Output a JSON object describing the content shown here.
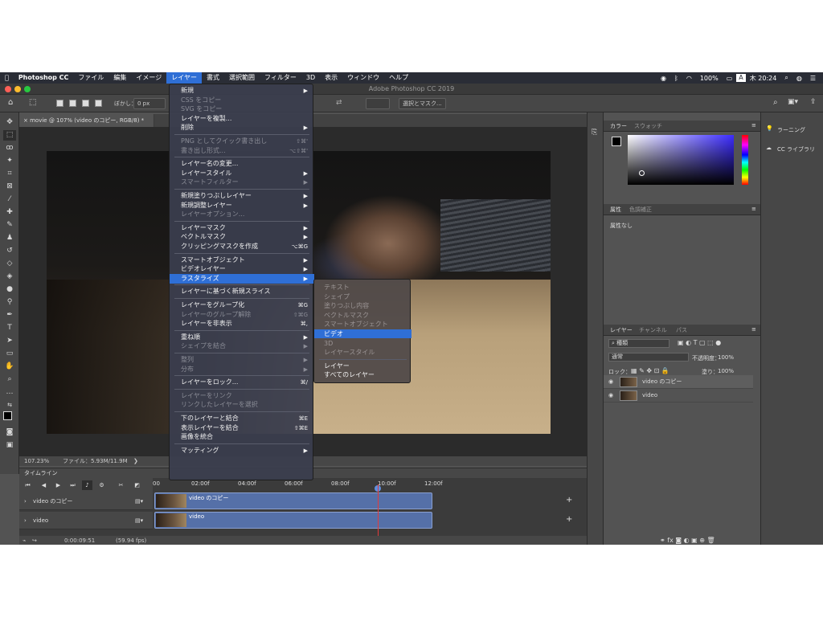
{
  "menubar": {
    "apple": "",
    "app": "Photoshop CC",
    "items": [
      "ファイル",
      "編集",
      "イメージ",
      "レイヤー",
      "書式",
      "選択範囲",
      "フィルター",
      "3D",
      "表示",
      "ウィンドウ",
      "ヘルプ"
    ],
    "active_index": 3,
    "battery": "100%",
    "clock": "木 20:24",
    "input_source": "A"
  },
  "window": {
    "title": "Adobe Photoshop CC 2019"
  },
  "options": {
    "feather_label": "ぼかし：",
    "feather_value": "0 px",
    "select_mask_label": "選択とマスク..."
  },
  "document": {
    "tab_label": "movie @ 107% (video のコピー, RGB/8) *",
    "zoom": "107.23%",
    "file_info": "ファイル：5.93M/11.9M"
  },
  "layer_menu": {
    "items": [
      {
        "label": "新規",
        "sc": "▶",
        "dis": false
      },
      {
        "label": "CSS をコピー",
        "sc": "",
        "dis": true
      },
      {
        "label": "SVG をコピー",
        "sc": "",
        "dis": true
      },
      {
        "label": "レイヤーを複製...",
        "sc": "",
        "dis": false
      },
      {
        "label": "削除",
        "sc": "▶",
        "dis": false
      },
      {
        "sep": true
      },
      {
        "label": "PNG としてクイック書き出し",
        "sc": "⇧⌘'",
        "dis": true
      },
      {
        "label": "書き出し形式...",
        "sc": "⌥⇧⌘'",
        "dis": true
      },
      {
        "sep": true
      },
      {
        "label": "レイヤー名の変更...",
        "sc": "",
        "dis": false
      },
      {
        "label": "レイヤースタイル",
        "sc": "▶",
        "dis": false
      },
      {
        "label": "スマートフィルター",
        "sc": "▶",
        "dis": true
      },
      {
        "sep": true
      },
      {
        "label": "新規塗りつぶしレイヤー",
        "sc": "▶",
        "dis": false
      },
      {
        "label": "新規調整レイヤー",
        "sc": "▶",
        "dis": false
      },
      {
        "label": "レイヤーオプション...",
        "sc": "",
        "dis": true
      },
      {
        "sep": true
      },
      {
        "label": "レイヤーマスク",
        "sc": "▶",
        "dis": false
      },
      {
        "label": "ベクトルマスク",
        "sc": "▶",
        "dis": false
      },
      {
        "label": "クリッピングマスクを作成",
        "sc": "⌥⌘G",
        "dis": false
      },
      {
        "sep": true
      },
      {
        "label": "スマートオブジェクト",
        "sc": "▶",
        "dis": false
      },
      {
        "label": "ビデオレイヤー",
        "sc": "▶",
        "dis": false
      },
      {
        "label": "ラスタライズ",
        "sc": "▶",
        "dis": false,
        "hl": true
      },
      {
        "sep": true
      },
      {
        "label": "レイヤーに基づく新規スライス",
        "sc": "",
        "dis": false
      },
      {
        "sep": true
      },
      {
        "label": "レイヤーをグループ化",
        "sc": "⌘G",
        "dis": false
      },
      {
        "label": "レイヤーのグループ解除",
        "sc": "⇧⌘G",
        "dis": true
      },
      {
        "label": "レイヤーを非表示",
        "sc": "⌘,",
        "dis": false
      },
      {
        "sep": true
      },
      {
        "label": "重ね順",
        "sc": "▶",
        "dis": false
      },
      {
        "label": "シェイプを結合",
        "sc": "▶",
        "dis": true
      },
      {
        "sep": true
      },
      {
        "label": "整列",
        "sc": "▶",
        "dis": true
      },
      {
        "label": "分布",
        "sc": "▶",
        "dis": true
      },
      {
        "sep": true
      },
      {
        "label": "レイヤーをロック...",
        "sc": "⌘/",
        "dis": false
      },
      {
        "sep": true
      },
      {
        "label": "レイヤーをリンク",
        "sc": "",
        "dis": true
      },
      {
        "label": "リンクしたレイヤーを選択",
        "sc": "",
        "dis": true
      },
      {
        "sep": true
      },
      {
        "label": "下のレイヤーと結合",
        "sc": "⌘E",
        "dis": false
      },
      {
        "label": "表示レイヤーを結合",
        "sc": "⇧⌘E",
        "dis": false
      },
      {
        "label": "画像を統合",
        "sc": "",
        "dis": false
      },
      {
        "sep": true
      },
      {
        "label": "マッティング",
        "sc": "▶",
        "dis": false
      }
    ]
  },
  "rasterize_submenu": {
    "items": [
      {
        "label": "テキスト",
        "dis": true
      },
      {
        "label": "シェイプ",
        "dis": true
      },
      {
        "label": "塗りつぶし内容",
        "dis": true
      },
      {
        "label": "ベクトルマスク",
        "dis": true
      },
      {
        "label": "スマートオブジェクト",
        "dis": true
      },
      {
        "label": "ビデオ",
        "dis": false,
        "hl": true
      },
      {
        "label": "3D",
        "dis": true
      },
      {
        "label": "レイヤースタイル",
        "dis": true
      },
      {
        "sep": true
      },
      {
        "label": "レイヤー",
        "dis": false
      },
      {
        "label": "すべてのレイヤー",
        "dis": false
      }
    ]
  },
  "timeline": {
    "title": "タイムライン",
    "ticks": [
      "00",
      "02:00f",
      "04:00f",
      "06:00f",
      "08:00f",
      "10:00f",
      "12:00f"
    ],
    "tracks": [
      {
        "label": "video のコピー",
        "clip": "video のコピー"
      },
      {
        "label": "video",
        "clip": "video"
      }
    ],
    "timecode": "0:00:09:51",
    "fps": "(59.94 fps)"
  },
  "color_panel": {
    "tab1": "カラー",
    "tab2": "スウォッチ"
  },
  "properties_panel": {
    "tab1": "属性",
    "tab2": "色調補正",
    "empty": "属性なし"
  },
  "layers_panel": {
    "tab1": "レイヤー",
    "tab2": "チャンネル",
    "tab3": "パス",
    "filter": "種類",
    "blend": "通常",
    "opacity_label": "不透明度：",
    "opacity": "100%",
    "lock_label": "ロック：",
    "fill_label": "塗り：",
    "fill": "100%",
    "layers": [
      "video のコピー",
      "video"
    ]
  },
  "far_panel": {
    "learn": "ラーニング",
    "libraries": "CC ライブラリ"
  },
  "colors": {
    "menu_bg": "#3a3e4e",
    "highlight": "#2f6fd6",
    "ui_panel": "#535353"
  }
}
